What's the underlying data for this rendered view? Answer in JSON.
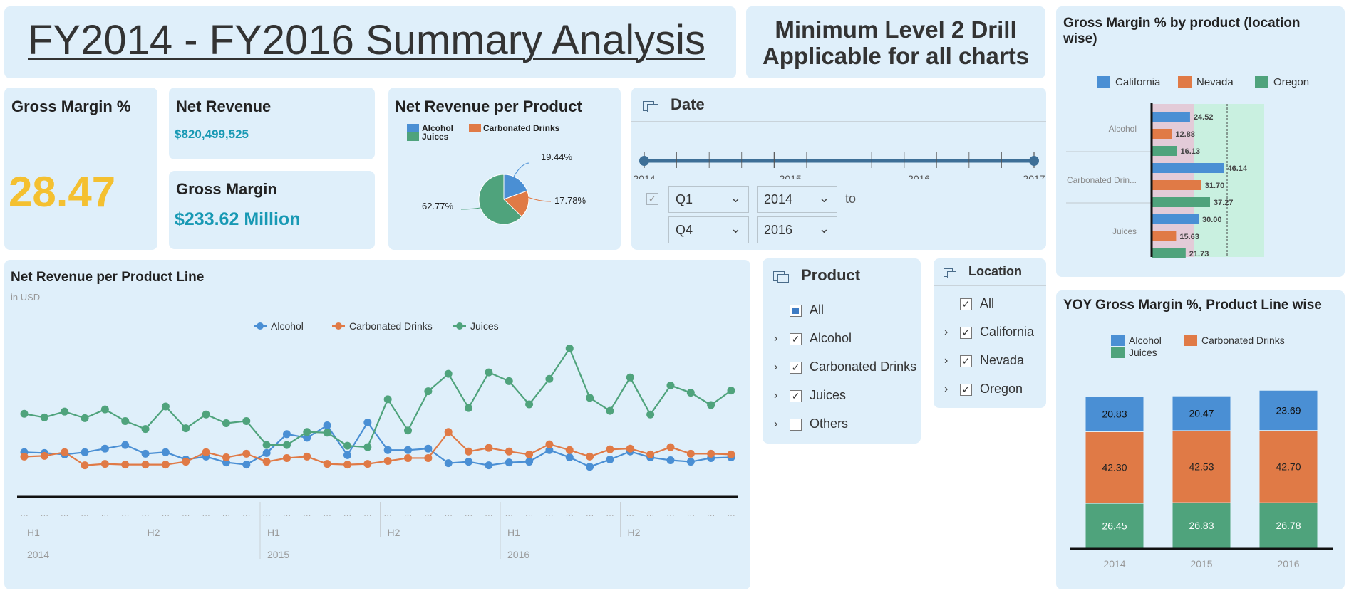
{
  "header": {
    "title": "FY2014 - FY2016 Summary Analysis",
    "note_line1": "Minimum Level 2 Drill",
    "note_line2": "Applicable for all charts"
  },
  "kpi": {
    "gross_margin_pct_title": "Gross Margin %",
    "gross_margin_pct_value": "28.47",
    "net_revenue_title": "Net Revenue",
    "net_revenue_value": "$820,499,525",
    "gross_margin_title": "Gross Margin",
    "gross_margin_value": "$233.62 Million"
  },
  "colors": {
    "alcohol": "#4a8fd4",
    "carbonated": "#e07a46",
    "juices": "#4fa37c",
    "accent": "#f4c030",
    "teal": "#1899b4"
  },
  "date_filter": {
    "title": "Date",
    "years": [
      "2014",
      "2015",
      "2016",
      "2017"
    ],
    "from_quarter": "Q1",
    "from_year": "2014",
    "to_label": "to",
    "to_quarter": "Q4",
    "to_year": "2016"
  },
  "product_filter": {
    "title": "Product",
    "items": [
      {
        "label": "All",
        "state": "partial"
      },
      {
        "label": "Alcohol",
        "state": "checked"
      },
      {
        "label": "Carbonated Drinks",
        "state": "checked"
      },
      {
        "label": "Juices",
        "state": "checked"
      },
      {
        "label": "Others",
        "state": "unchecked"
      }
    ]
  },
  "location_filter": {
    "title": "Location",
    "items": [
      {
        "label": "All",
        "state": "checked"
      },
      {
        "label": "California",
        "state": "checked"
      },
      {
        "label": "Nevada",
        "state": "checked"
      },
      {
        "label": "Oregon",
        "state": "checked"
      }
    ]
  },
  "chart_data": [
    {
      "id": "pie",
      "type": "pie",
      "title": "Net Revenue per Product",
      "legend": [
        "Alcohol",
        "Carbonated Drinks",
        "Juices"
      ],
      "values": [
        19.44,
        17.78,
        62.77
      ],
      "labels": [
        "19.44%",
        "17.78%",
        "62.77%"
      ]
    },
    {
      "id": "line",
      "type": "line",
      "title": "Net Revenue per Product Line",
      "subtitle": "in USD",
      "x_half_labels": [
        "H1",
        "H2",
        "H1",
        "H2",
        "H1",
        "H2"
      ],
      "x_year_labels": [
        "2014",
        "2015",
        "2016"
      ],
      "series": [
        {
          "name": "Alcohol",
          "values": [
            35,
            34,
            32,
            35,
            40,
            45,
            33,
            35,
            25,
            29,
            21,
            18,
            34,
            60,
            55,
            72,
            31,
            76,
            38,
            38,
            40,
            20,
            22,
            17,
            21,
            22,
            38,
            28,
            15,
            25,
            36,
            28,
            24,
            22,
            27,
            28
          ]
        },
        {
          "name": "Carbonated Drinks",
          "values": [
            29,
            30,
            35,
            17,
            19,
            18,
            18,
            18,
            22,
            35,
            28,
            33,
            22,
            27,
            29,
            19,
            18,
            19,
            23,
            27,
            27,
            63,
            36,
            41,
            36,
            32,
            46,
            38,
            29,
            39,
            40,
            32,
            42,
            33,
            33,
            32
          ]
        },
        {
          "name": "Juices",
          "values": [
            88,
            83,
            91,
            82,
            94,
            78,
            67,
            98,
            68,
            87,
            75,
            78,
            45,
            45,
            63,
            62,
            44,
            42,
            108,
            65,
            119,
            143,
            96,
            145,
            133,
            101,
            136,
            178,
            110,
            92,
            138,
            87,
            127,
            117,
            100,
            120
          ]
        }
      ]
    },
    {
      "id": "hbar",
      "type": "bar",
      "title": "Gross Margin % by product (location wise)",
      "categories": [
        "Alcohol",
        "Carbonated Drin...",
        "Juices"
      ],
      "series": [
        {
          "name": "California",
          "values": [
            24.52,
            46.14,
            30.0
          ]
        },
        {
          "name": "Nevada",
          "values": [
            12.88,
            31.7,
            15.63
          ]
        },
        {
          "name": "Oregon",
          "values": [
            16.13,
            37.27,
            21.73
          ]
        }
      ],
      "labels": [
        [
          "24.52",
          "12.88",
          "16.13"
        ],
        [
          "46.14",
          "31.70",
          "37.27"
        ],
        [
          "30.00",
          "15.63",
          "21.73"
        ]
      ]
    },
    {
      "id": "yoy",
      "type": "bar",
      "title": "YOY Gross Margin %, Product Line wise",
      "categories": [
        "2014",
        "2015",
        "2016"
      ],
      "series": [
        {
          "name": "Alcohol",
          "values": [
            20.83,
            20.47,
            23.69
          ]
        },
        {
          "name": "Carbonated Drinks",
          "values": [
            42.3,
            42.53,
            42.7
          ]
        },
        {
          "name": "Juices",
          "values": [
            26.45,
            26.83,
            26.78
          ]
        }
      ],
      "labels": [
        [
          "20.83",
          "20.47",
          "23.69"
        ],
        [
          "42.30",
          "42.53",
          "42.70"
        ],
        [
          "26.45",
          "26.83",
          "26.78"
        ]
      ]
    }
  ]
}
